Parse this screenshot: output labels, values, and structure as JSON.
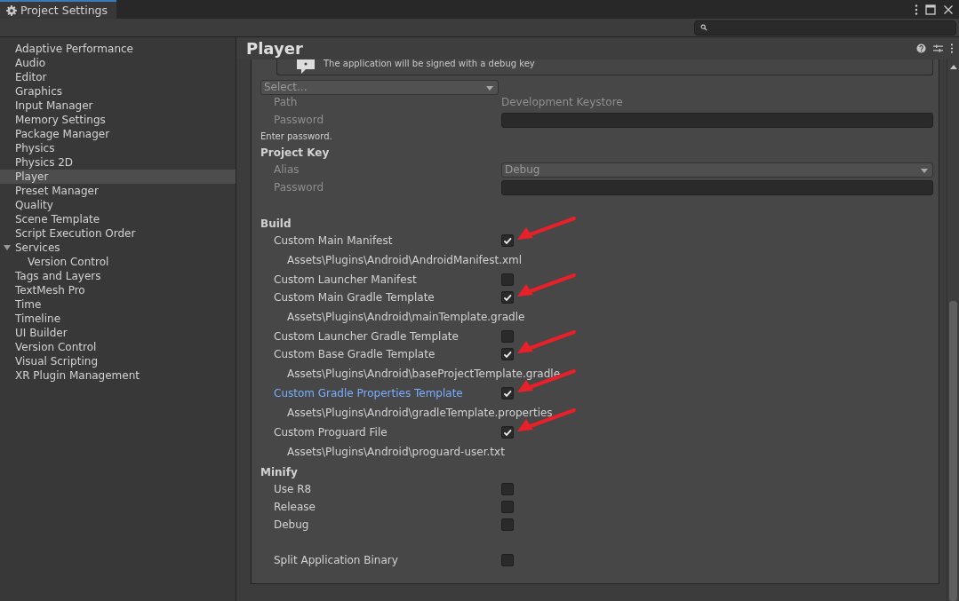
{
  "window": {
    "tab_title": "Project Settings",
    "tab_selected": true
  },
  "sidebar": {
    "items": [
      {
        "label": "Adaptive Performance",
        "selected": false
      },
      {
        "label": "Audio",
        "selected": false
      },
      {
        "label": "Editor",
        "selected": false
      },
      {
        "label": "Graphics",
        "selected": false
      },
      {
        "label": "Input Manager",
        "selected": false
      },
      {
        "label": "Memory Settings",
        "selected": false
      },
      {
        "label": "Package Manager",
        "selected": false
      },
      {
        "label": "Physics",
        "selected": false
      },
      {
        "label": "Physics 2D",
        "selected": false
      },
      {
        "label": "Player",
        "selected": true
      },
      {
        "label": "Preset Manager",
        "selected": false
      },
      {
        "label": "Quality",
        "selected": false
      },
      {
        "label": "Scene Template",
        "selected": false
      },
      {
        "label": "Script Execution Order",
        "selected": false
      },
      {
        "label": "Services",
        "selected": false,
        "expanded": true,
        "children": [
          {
            "label": "Version Control",
            "selected": false
          }
        ]
      },
      {
        "label": "Tags and Layers",
        "selected": false
      },
      {
        "label": "TextMesh Pro",
        "selected": false
      },
      {
        "label": "Time",
        "selected": false
      },
      {
        "label": "Timeline",
        "selected": false
      },
      {
        "label": "UI Builder",
        "selected": false
      },
      {
        "label": "Version Control",
        "selected": false
      },
      {
        "label": "Visual Scripting",
        "selected": false
      },
      {
        "label": "XR Plugin Management",
        "selected": false
      }
    ]
  },
  "panel": {
    "title": "Player",
    "rows": [
      {
        "kind": "helpbox",
        "text": "The application will be signed with a debug key"
      },
      {
        "kind": "dropdown",
        "value": "Select..."
      },
      {
        "kind": "text",
        "label": "Path",
        "value": "Development Keystore"
      },
      {
        "kind": "field",
        "label": "Password"
      },
      {
        "kind": "note",
        "text": "Enter password."
      },
      {
        "kind": "header",
        "text": "Project Key"
      },
      {
        "kind": "select",
        "label": "Alias",
        "value": "Debug"
      },
      {
        "kind": "field",
        "label": "Password"
      },
      {
        "kind": "gap"
      },
      {
        "kind": "header",
        "text": "Build"
      },
      {
        "kind": "toggle",
        "label": "Custom Main Manifest",
        "checked": true,
        "highlighted": false,
        "arrow": true
      },
      {
        "kind": "path",
        "text": "Assets\\Plugins\\Android\\AndroidManifest.xml"
      },
      {
        "kind": "toggle",
        "label": "Custom Launcher Manifest",
        "checked": false,
        "highlighted": false,
        "arrow": false
      },
      {
        "kind": "toggle",
        "label": "Custom Main Gradle Template",
        "checked": true,
        "highlighted": false,
        "arrow": true
      },
      {
        "kind": "path",
        "text": "Assets\\Plugins\\Android\\mainTemplate.gradle"
      },
      {
        "kind": "toggle",
        "label": "Custom Launcher Gradle Template",
        "checked": false,
        "highlighted": false,
        "arrow": false
      },
      {
        "kind": "toggle",
        "label": "Custom Base Gradle Template",
        "checked": true,
        "highlighted": false,
        "arrow": true
      },
      {
        "kind": "path",
        "text": "Assets\\Plugins\\Android\\baseProjectTemplate.gradle"
      },
      {
        "kind": "toggle",
        "label": "Custom Gradle Properties Template",
        "checked": true,
        "highlighted": true,
        "arrow": true
      },
      {
        "kind": "path",
        "text": "Assets\\Plugins\\Android\\gradleTemplate.properties"
      },
      {
        "kind": "toggle",
        "label": "Custom Proguard File",
        "checked": true,
        "highlighted": false,
        "arrow": true
      },
      {
        "kind": "path",
        "text": "Assets\\Plugins\\Android\\proguard-user.txt"
      },
      {
        "kind": "header",
        "text": "Minify"
      },
      {
        "kind": "toggle",
        "label": "Use R8",
        "checked": false,
        "highlighted": false,
        "arrow": false
      },
      {
        "kind": "toggle",
        "label": "Release",
        "checked": false,
        "highlighted": false,
        "arrow": false
      },
      {
        "kind": "toggle",
        "label": "Debug",
        "checked": false,
        "highlighted": false,
        "arrow": false
      },
      {
        "kind": "gap"
      },
      {
        "kind": "toggle",
        "label": "Split Application Binary",
        "checked": false,
        "highlighted": false,
        "arrow": false
      }
    ]
  }
}
